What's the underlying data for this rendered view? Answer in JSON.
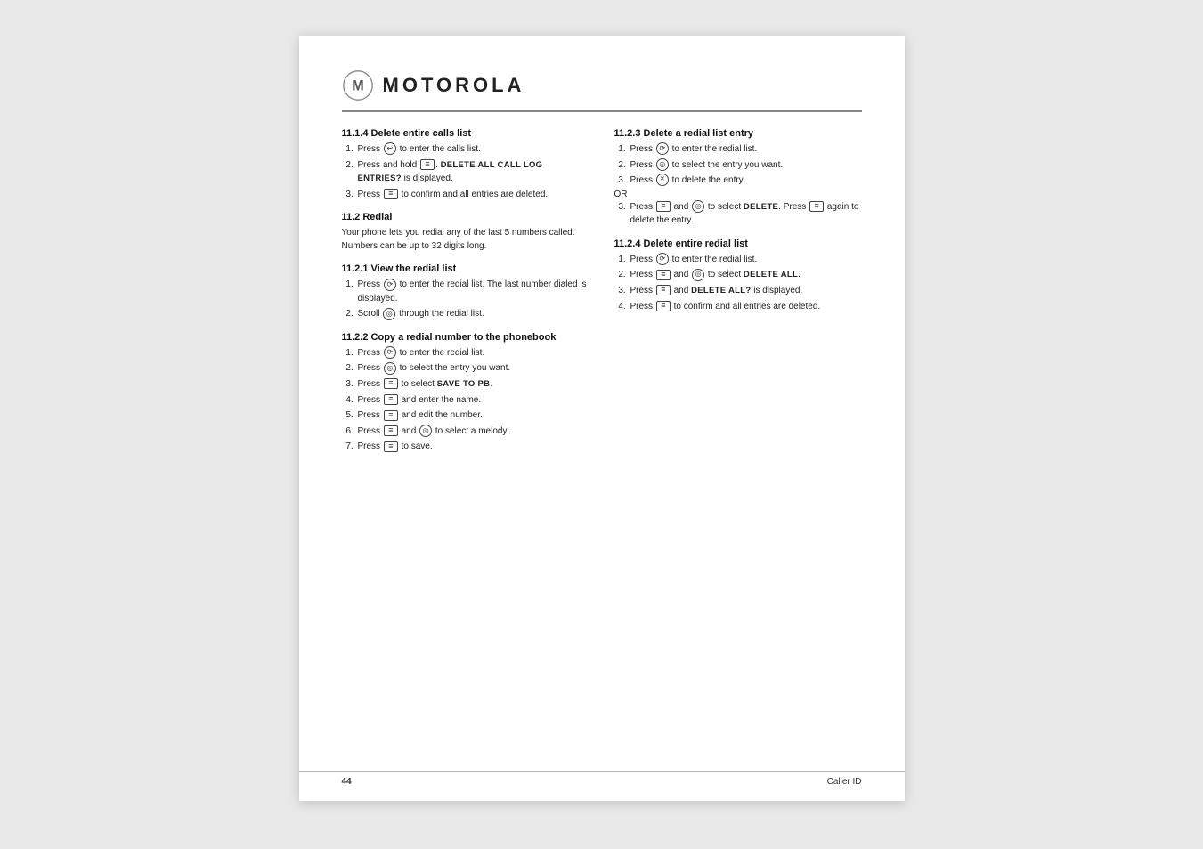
{
  "page": {
    "logo_text": "MOTOROLA",
    "page_number": "44",
    "footer_section": "Caller ID"
  },
  "left_column": {
    "section_1114": {
      "title": "11.1.4   Delete entire calls list",
      "steps": [
        "Press [call-icon] to enter the calls list.",
        "Press and hold [menu-icon]. DELETE ALL CALL LOG ENTRIES? is displayed.",
        "Press [menu-icon] to confirm and all entries are deleted."
      ]
    },
    "section_112": {
      "title": "11.2   Redial",
      "intro": "Your phone lets you redial any of the last 5 numbers called. Numbers can be up to 32 digits long."
    },
    "section_1121": {
      "title": "11.2.1   View the redial list",
      "steps": [
        "Press [redial-icon] to enter the redial list. The last number dialed is displayed.",
        "Scroll [scroll-icon] through the redial list."
      ]
    },
    "section_1122": {
      "title": "11.2.2   Copy a redial number to the phonebook",
      "steps": [
        "Press [redial-icon] to enter the redial list.",
        "Press [scroll-icon] to select the entry you want.",
        "Press [menu-icon] to select SAVE TO PB.",
        "Press [menu-icon] and enter the name.",
        "Press [menu-icon] and edit the number.",
        "Press [menu-icon] and [scroll-icon] to select a melody.",
        "Press [menu-icon] to save."
      ]
    }
  },
  "right_column": {
    "section_1123": {
      "title": "11.2.3   Delete a redial list entry",
      "steps": [
        "Press [redial-icon] to enter the redial list.",
        "Press [scroll-icon] to select the entry you want.",
        "Press [delete-icon] to delete the entry."
      ],
      "or": "OR",
      "step_alt": "Press [menu-icon] and [scroll-icon] to select DELETE. Press [menu-icon] again to delete the entry."
    },
    "section_1124": {
      "title": "11.2.4   Delete entire redial list",
      "steps": [
        "Press [redial-icon] to enter the redial list.",
        "Press [menu-icon] and [scroll-icon] to select DELETE ALL.",
        "Press [menu-icon] and DELETE ALL? is displayed.",
        "Press [menu-icon] to confirm and all entries are deleted."
      ]
    }
  }
}
